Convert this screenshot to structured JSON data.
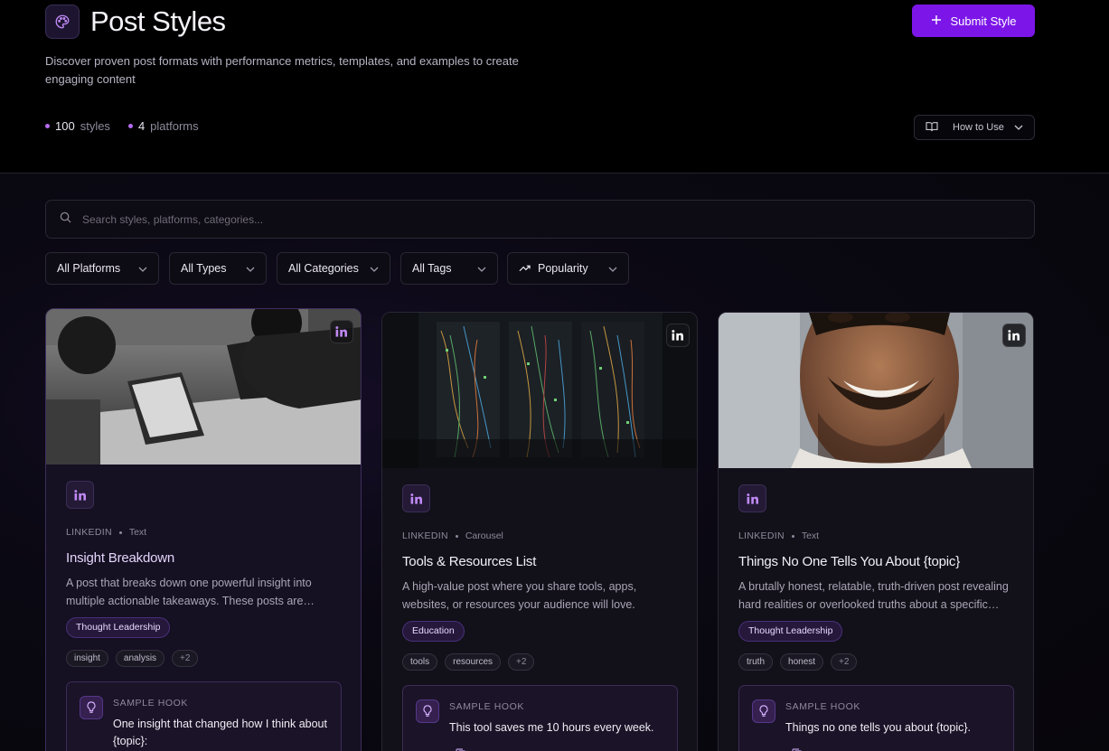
{
  "header": {
    "title": "Post Styles",
    "subtitle": "Discover proven post formats with performance metrics, templates, and examples to create engaging content",
    "submit_label": "Submit Style",
    "howto_label": "How to Use"
  },
  "stats": [
    {
      "num": "100",
      "label": "styles"
    },
    {
      "num": "4",
      "label": "platforms"
    }
  ],
  "search": {
    "placeholder": "Search styles, platforms, categories..."
  },
  "filters": [
    {
      "label": "All Platforms"
    },
    {
      "label": "All Types"
    },
    {
      "label": "All Categories"
    },
    {
      "label": "All Tags"
    },
    {
      "label": "Popularity"
    }
  ],
  "cards": [
    {
      "platform": "LINKEDIN",
      "type": "Text",
      "title": "Insight Breakdown",
      "description": "A post that breaks down one powerful insight into multiple actionable takeaways. These posts are…",
      "category": "Thought Leadership",
      "tags": [
        "insight",
        "analysis",
        "+2"
      ],
      "hook_label": "SAMPLE HOOK",
      "hook_text": "One insight that changed how I think about {topic}:"
    },
    {
      "platform": "LINKEDIN",
      "type": "Carousel",
      "title": "Tools & Resources List",
      "description": "A high-value post where you share tools, apps, websites, or resources your audience will love.",
      "category": "Education",
      "tags": [
        "tools",
        "resources",
        "+2"
      ],
      "hook_label": "SAMPLE HOOK",
      "hook_text": "This tool saves me 10 hours every week."
    },
    {
      "platform": "LINKEDIN",
      "type": "Text",
      "title": "Things No One Tells You About {topic}",
      "description": "A brutally honest, relatable, truth-driven post revealing hard realities or overlooked truths about a specific…",
      "category": "Thought Leadership",
      "tags": [
        "truth",
        "honest",
        "+2"
      ],
      "hook_label": "SAMPLE HOOK",
      "hook_text": "Things no one tells you about {topic}."
    }
  ],
  "colors": {
    "accent": "#7c16e8",
    "pill_bg": "#26183b",
    "icon_purple": "#c08af5"
  }
}
